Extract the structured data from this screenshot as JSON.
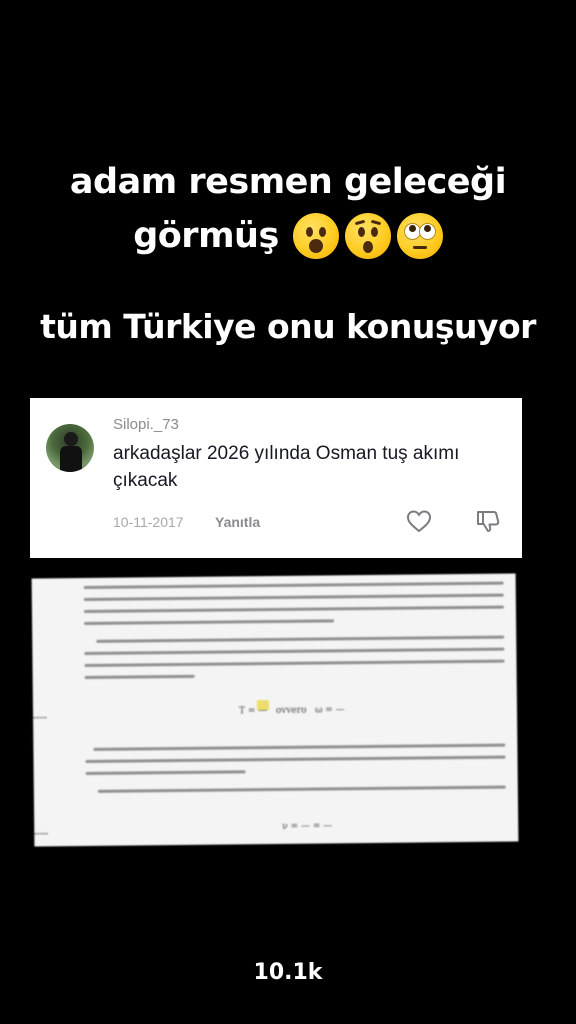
{
  "overlay": {
    "line1": "adam resmen geleceği",
    "line2": "görmüş",
    "line2_emojis": [
      "face-with-open-mouth-emoji",
      "hushed-face-emoji",
      "face-with-rolling-eyes-emoji"
    ],
    "line3": "tüm Türkiye onu konuşuyor"
  },
  "comment": {
    "username": "Silopi._73",
    "text": "arkadaşlar 2026 yılında Osman tuş akımı çıkacak",
    "date": "10-11-2017",
    "reply_label": "Yanıtla",
    "icons": [
      "heart-icon",
      "thumbs-down-icon"
    ]
  },
  "photo": {
    "description_type": "textbook-page-photo"
  },
  "stats": {
    "views": "10.1k"
  },
  "colors": {
    "background": "#000000",
    "card": "#ffffff",
    "text_primary": "#161823",
    "text_secondary": "#8a8b91"
  }
}
